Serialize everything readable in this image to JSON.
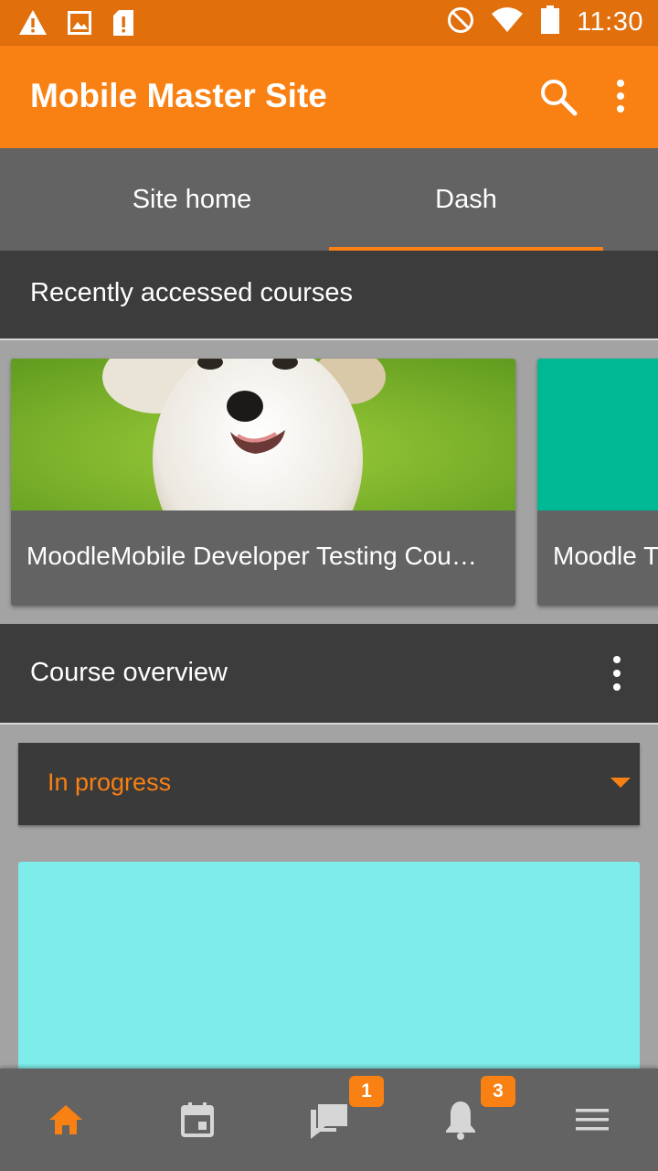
{
  "status_bar": {
    "time": "11:30",
    "icons": [
      "warning-icon",
      "image-icon",
      "sd-card-alert-icon",
      "do-not-disturb-icon",
      "wifi-icon",
      "battery-icon"
    ]
  },
  "app_bar": {
    "title": "Mobile Master Site",
    "actions": [
      "search-icon",
      "more-vertical-icon"
    ]
  },
  "tabs": [
    {
      "label": "Site home",
      "selected": false
    },
    {
      "label": "Dash",
      "selected": true
    }
  ],
  "recent_courses": {
    "heading": "Recently accessed courses",
    "courses": [
      {
        "name": "MoodleMobile Developer Testing Cou…",
        "image": "puppy-photo"
      },
      {
        "name": "Moodle T",
        "image_color": "#00b894"
      }
    ]
  },
  "course_overview": {
    "heading": "Course overview",
    "filter_value": "In progress",
    "first_course_color": "#7eecea"
  },
  "bottom_nav": [
    {
      "icon": "home-icon",
      "active": true
    },
    {
      "icon": "calendar-icon",
      "active": false
    },
    {
      "icon": "messages-icon",
      "badge": "1"
    },
    {
      "icon": "notifications-icon",
      "badge": "3"
    },
    {
      "icon": "menu-icon",
      "active": false
    }
  ],
  "colors": {
    "brand": "#f98012",
    "status_bar": "#e06f0c",
    "tab_bar": "#636363",
    "header": "#3c3c3c"
  }
}
